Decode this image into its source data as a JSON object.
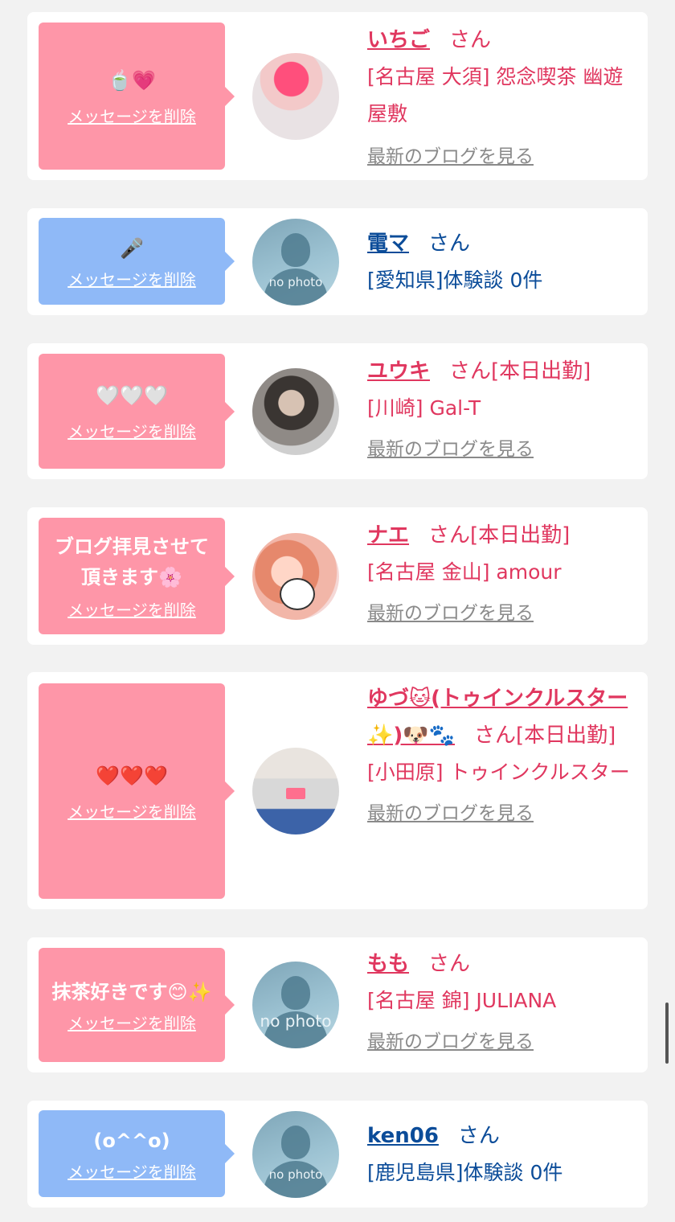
{
  "delete_label": "メッセージを削除",
  "san_label": "さん",
  "blog_label": "最新のブログを見る",
  "cards": [
    {
      "message": "🍵💗",
      "name": "いちご",
      "status": "",
      "shop": "[名古屋 大須] 怨念喫茶 幽遊屋敷",
      "blog": true,
      "theme": "pink"
    },
    {
      "message": "🎤",
      "name": "電マ",
      "status": "",
      "shop": "[愛知県]体験談 0件",
      "blog": false,
      "theme": "blue",
      "avatar_text": "no photo"
    },
    {
      "message": "🤍🤍🤍",
      "name": "ユウキ",
      "status": "[本日出勤]",
      "shop": "[川崎] Gal-T",
      "blog": true,
      "theme": "pink"
    },
    {
      "message": "ブログ拝見させて頂きます🌸",
      "name": "ナエ",
      "status": "[本日出勤]",
      "shop": "[名古屋 金山] amour",
      "blog": true,
      "theme": "pink"
    },
    {
      "message": "❤️❤️❤️",
      "name": "ゆづ🐱(トゥインクルスター✨)🐶🐾",
      "status": "[本日出勤]",
      "shop": "[小田原] トゥインクルスター",
      "blog": true,
      "theme": "pink"
    },
    {
      "message": "抹茶好きです😊✨",
      "name": "もも",
      "status": "",
      "shop": "[名古屋 錦] JULIANA",
      "blog": true,
      "theme": "pink",
      "avatar_text": "no photo"
    },
    {
      "message": "(o^^o)",
      "name": "ken06",
      "status": "",
      "shop": "[鹿児島県]体験談 0件",
      "blog": false,
      "theme": "blue",
      "avatar_text": "no photo"
    }
  ]
}
